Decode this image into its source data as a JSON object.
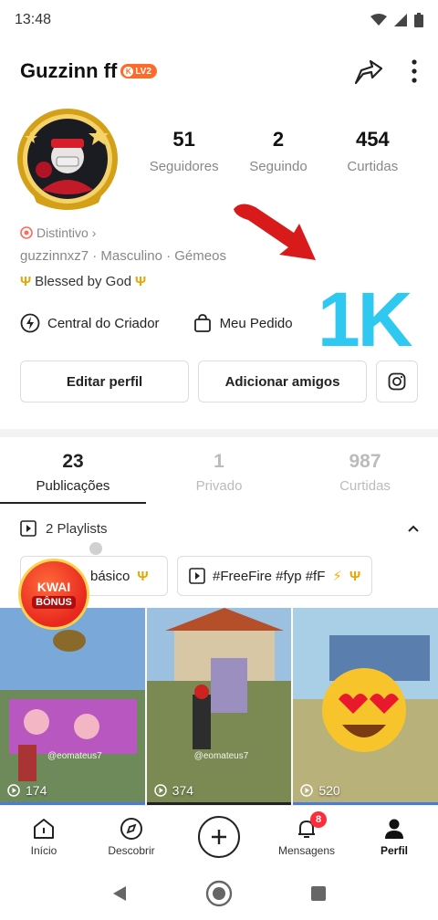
{
  "status_bar": {
    "time": "13:48"
  },
  "profile": {
    "name": "Guzzinn ff",
    "level_badge": "LV2",
    "stats": [
      {
        "value": "51",
        "label": "Seguidores"
      },
      {
        "value": "2",
        "label": "Seguindo"
      },
      {
        "value": "454",
        "label": "Curtidas"
      }
    ],
    "distintivo": "Distintivo",
    "handle": "guzzinnxz7",
    "gender": "Masculino",
    "sign": "Gémeos",
    "bio": "Blessed by God",
    "overlay_text": "1K"
  },
  "creator_links": {
    "central": "Central do Criador",
    "pedido": "Meu Pedido"
  },
  "buttons": {
    "edit": "Editar perfil",
    "add_friends": "Adicionar amigos"
  },
  "tabs": [
    {
      "count": "23",
      "label": "Publicações"
    },
    {
      "count": "1",
      "label": "Privado"
    },
    {
      "count": "987",
      "label": "Curtidas"
    }
  ],
  "playlists": {
    "header": "2 Playlists",
    "chips": [
      "básico",
      "#FreeFire #fyp #fF"
    ]
  },
  "kwai_bonus": {
    "line1": "KWAI",
    "line2": "BÔNUS"
  },
  "videos": [
    {
      "views": "174",
      "watermark": "@eomateus7"
    },
    {
      "views": "374",
      "watermark": "@eomateus7"
    },
    {
      "views": "520",
      "watermark": ""
    }
  ],
  "bottom_nav": [
    {
      "label": "Início",
      "icon": "home-icon"
    },
    {
      "label": "Descobrir",
      "icon": "compass-icon"
    },
    {
      "label": "",
      "icon": "add-icon"
    },
    {
      "label": "Mensagens",
      "icon": "bell-icon",
      "badge": "8"
    },
    {
      "label": "Perfil",
      "icon": "person-icon"
    }
  ],
  "colors": {
    "accent": "#ff6a2a",
    "overlay": "#2fc8f0",
    "badge": "#ff2d3a"
  }
}
